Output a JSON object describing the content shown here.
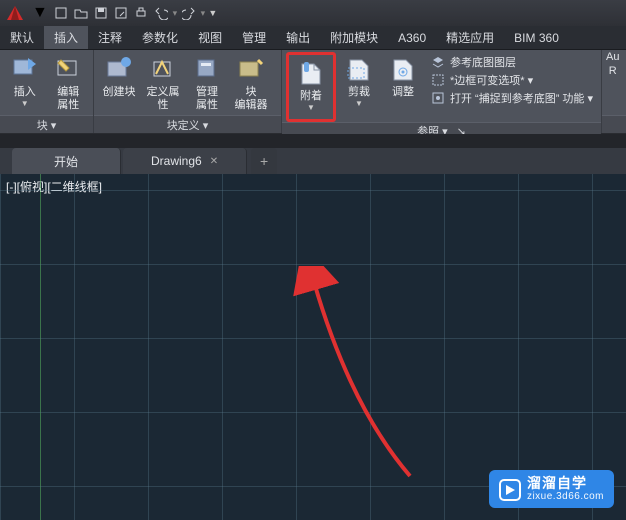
{
  "menubar": {
    "tabs": [
      "默认",
      "插入",
      "注释",
      "参数化",
      "视图",
      "管理",
      "输出",
      "附加模块",
      "A360",
      "精选应用",
      "BIM 360"
    ],
    "active_index": 1
  },
  "ribbon": {
    "panel_block": {
      "title": "块 ▾",
      "insert": "插入",
      "edit": "编辑\n属性"
    },
    "panel_blockdef": {
      "title": "块定义 ▾",
      "create": "创建块",
      "defattr": "定义属性",
      "mgrattr": "管理\n属性",
      "blkedit": "块\n编辑器"
    },
    "panel_ref": {
      "title": "参照 ▾",
      "attach": "附着",
      "clip": "剪裁",
      "adjust": "调整",
      "rows": [
        "参考底图图层",
        "*边框可变选项* ▾",
        "打开 “捕捉到参考底图” 功能 ▾"
      ]
    },
    "panel_au": {
      "l1": "Au",
      "l2": "R"
    }
  },
  "doctabs": {
    "home": "开始",
    "file1": "Drawing6",
    "plus": "+"
  },
  "canvas": {
    "viewlabel": "[-][俯视][二维线框]"
  },
  "watermark": {
    "brand": "溜溜自学",
    "sub": "zixue.3d66.com"
  }
}
